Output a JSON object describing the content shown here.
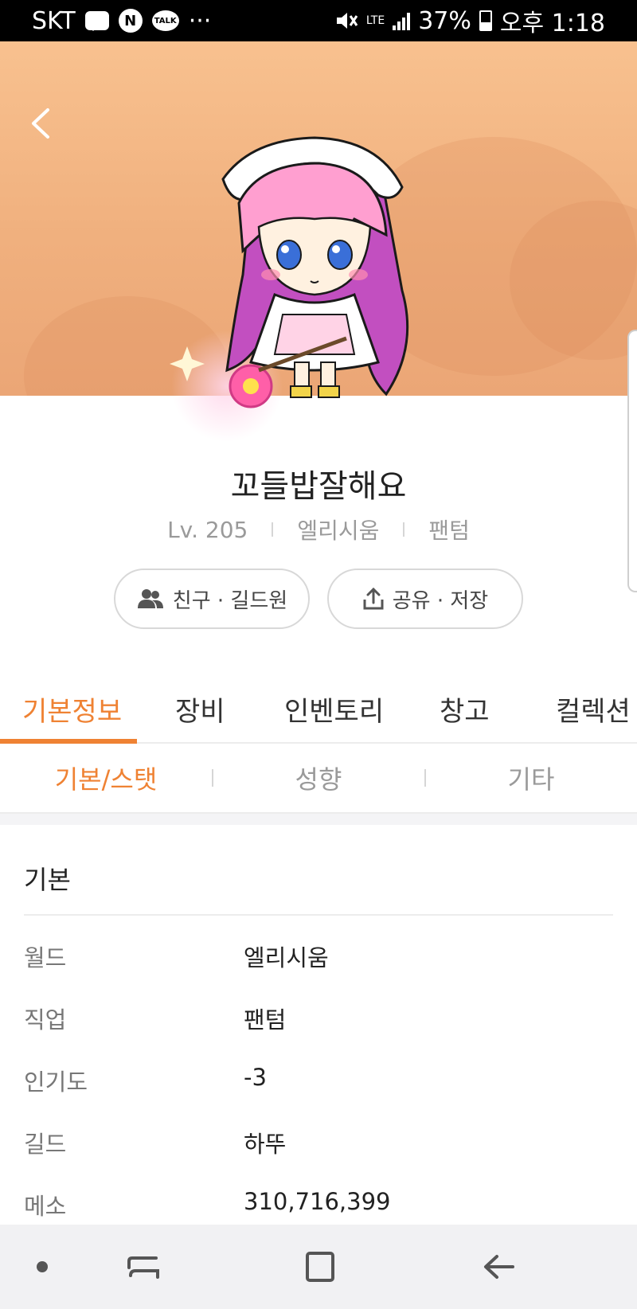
{
  "status_bar": {
    "carrier": "SKT",
    "talk_label": "TALK",
    "n_label": "N",
    "more": "···",
    "network": "LTE",
    "battery": "37%",
    "time": "오후 1:18"
  },
  "profile": {
    "name": "꼬들밥잘해요",
    "level": "Lv. 205",
    "world": "엘리시움",
    "job": "팬텀"
  },
  "actions": {
    "friends_label": "친구 · 길드원",
    "share_label": "공유 · 저장"
  },
  "tabs": [
    {
      "label": "기본정보",
      "active": true
    },
    {
      "label": "장비",
      "active": false
    },
    {
      "label": "인벤토리",
      "active": false
    },
    {
      "label": "창고",
      "active": false
    },
    {
      "label": "컬렉션",
      "active": false
    }
  ],
  "subtabs": [
    {
      "label": "기본/스탯",
      "active": true
    },
    {
      "label": "성향",
      "active": false
    },
    {
      "label": "기타",
      "active": false
    }
  ],
  "section": {
    "title": "기본",
    "rows": [
      {
        "label": "월드",
        "value": "엘리시움"
      },
      {
        "label": "직업",
        "value": "팬텀"
      },
      {
        "label": "인기도",
        "value": "-3"
      },
      {
        "label": "길드",
        "value": "하뚜"
      },
      {
        "label": "메소",
        "value": "310,716,399"
      }
    ]
  },
  "colors": {
    "accent": "#ef8233",
    "hero_top": "#f8c18f",
    "hero_bottom": "#eba676"
  }
}
